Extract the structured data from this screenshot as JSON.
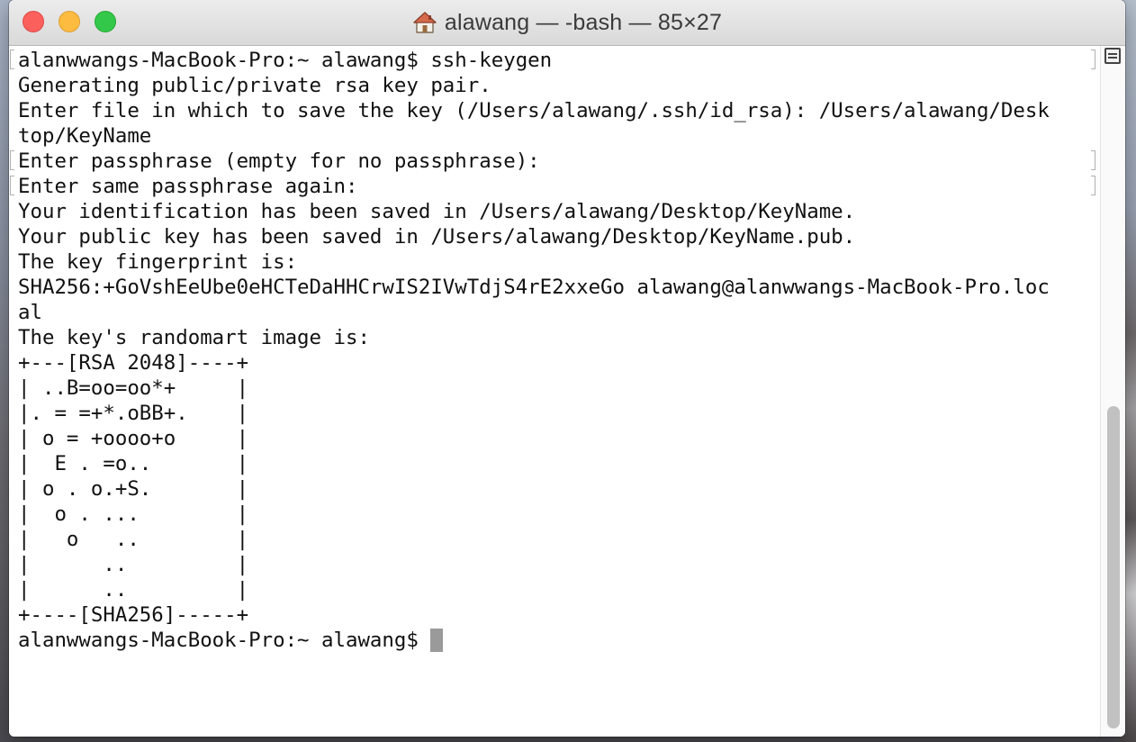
{
  "window": {
    "title": "alawang — -bash — 85×27",
    "icons": {
      "title_icon": "home-icon",
      "split": "split-pane-icon"
    },
    "colors": {
      "close": "#fc605c",
      "minimize": "#fdbc40",
      "zoom": "#34c84a",
      "cursor": "#9a9a9a"
    }
  },
  "terminal": {
    "lines": [
      {
        "text": "alanwwangs-MacBook-Pro:~ alawang$ ssh-keygen",
        "marked": true
      },
      {
        "text": "Generating public/private rsa key pair.",
        "marked": false
      },
      {
        "text": "Enter file in which to save the key (/Users/alawang/.ssh/id_rsa): /Users/alawang/Desk",
        "marked": false
      },
      {
        "text": "top/KeyName",
        "marked": false
      },
      {
        "text": "Enter passphrase (empty for no passphrase):",
        "marked": true
      },
      {
        "text": "Enter same passphrase again:",
        "marked": true
      },
      {
        "text": "Your identification has been saved in /Users/alawang/Desktop/KeyName.",
        "marked": false
      },
      {
        "text": "Your public key has been saved in /Users/alawang/Desktop/KeyName.pub.",
        "marked": false
      },
      {
        "text": "The key fingerprint is:",
        "marked": false
      },
      {
        "text": "SHA256:+GoVshEeUbe0eHCTeDaHHCrwIS2IVwTdjS4rE2xxeGo alawang@alanwwangs-MacBook-Pro.loc",
        "marked": false
      },
      {
        "text": "al",
        "marked": false
      },
      {
        "text": "The key's randomart image is:",
        "marked": false
      },
      {
        "text": "+---[RSA 2048]----+",
        "marked": false
      },
      {
        "text": "| ..B=oo=oo*+     |",
        "marked": false
      },
      {
        "text": "|. = =+*.oBB+.    |",
        "marked": false
      },
      {
        "text": "| o = +oooo+o     |",
        "marked": false
      },
      {
        "text": "|  E . =o..       |",
        "marked": false
      },
      {
        "text": "| o . o.+S.       |",
        "marked": false
      },
      {
        "text": "|  o . ...        |",
        "marked": false
      },
      {
        "text": "|   o   ..        |",
        "marked": false
      },
      {
        "text": "|      ..         |",
        "marked": false
      },
      {
        "text": "|      ..         |",
        "marked": false
      },
      {
        "text": "+----[SHA256]-----+",
        "marked": false
      }
    ],
    "prompt": "alanwwangs-MacBook-Pro:~ alawang$ "
  }
}
